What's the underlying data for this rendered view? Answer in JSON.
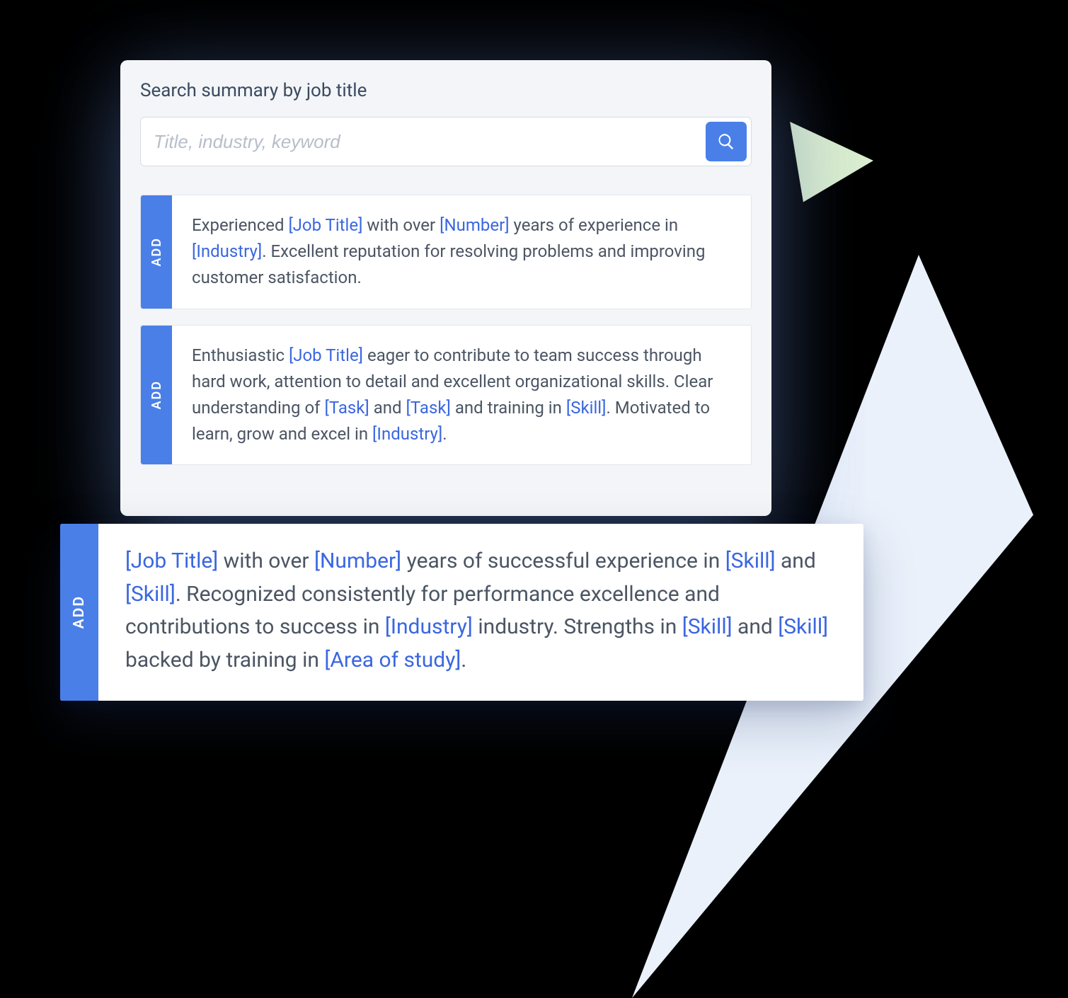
{
  "panel": {
    "title": "Search summary by job title",
    "search_placeholder": "Title, industry, keyword"
  },
  "add_label": "ADD",
  "cards": [
    {
      "segments": [
        {
          "t": "Experienced "
        },
        {
          "t": "[Job Title]",
          "tok": true
        },
        {
          "t": " with over "
        },
        {
          "t": "[Number]",
          "tok": true
        },
        {
          "t": " years of experience in "
        },
        {
          "t": "[Industry]",
          "tok": true
        },
        {
          "t": ". Excellent reputation for resolving problems and improving customer satisfaction."
        }
      ]
    },
    {
      "segments": [
        {
          "t": "Enthusiastic "
        },
        {
          "t": "[Job Title]",
          "tok": true
        },
        {
          "t": " eager to contribute to team success through hard work, attention to detail and excellent organizational skills. Clear understanding of "
        },
        {
          "t": "[Task]",
          "tok": true
        },
        {
          "t": " and "
        },
        {
          "t": "[Task]",
          "tok": true
        },
        {
          "t": " and training in "
        },
        {
          "t": "[Skill]",
          "tok": true
        },
        {
          "t": ". Motivated to learn, grow and excel in "
        },
        {
          "t": "[Industry]",
          "tok": true
        },
        {
          "t": "."
        }
      ]
    }
  ],
  "popout": {
    "segments": [
      {
        "t": "[Job Title]",
        "tok": true
      },
      {
        "t": " with over "
      },
      {
        "t": "[Number]",
        "tok": true
      },
      {
        "t": " years of successful experience in "
      },
      {
        "t": "[Skill]",
        "tok": true
      },
      {
        "t": " and "
      },
      {
        "t": "[Skill]",
        "tok": true
      },
      {
        "t": ". Recognized consistently for performance excellence and contributions to success in "
      },
      {
        "t": "[Industry]",
        "tok": true
      },
      {
        "t": " industry. Strengths in "
      },
      {
        "t": "[Skill]",
        "tok": true
      },
      {
        "t": " and "
      },
      {
        "t": "[Skill]",
        "tok": true
      },
      {
        "t": " backed by training in "
      },
      {
        "t": "[Area of study]",
        "tok": true
      },
      {
        "t": "."
      }
    ]
  }
}
